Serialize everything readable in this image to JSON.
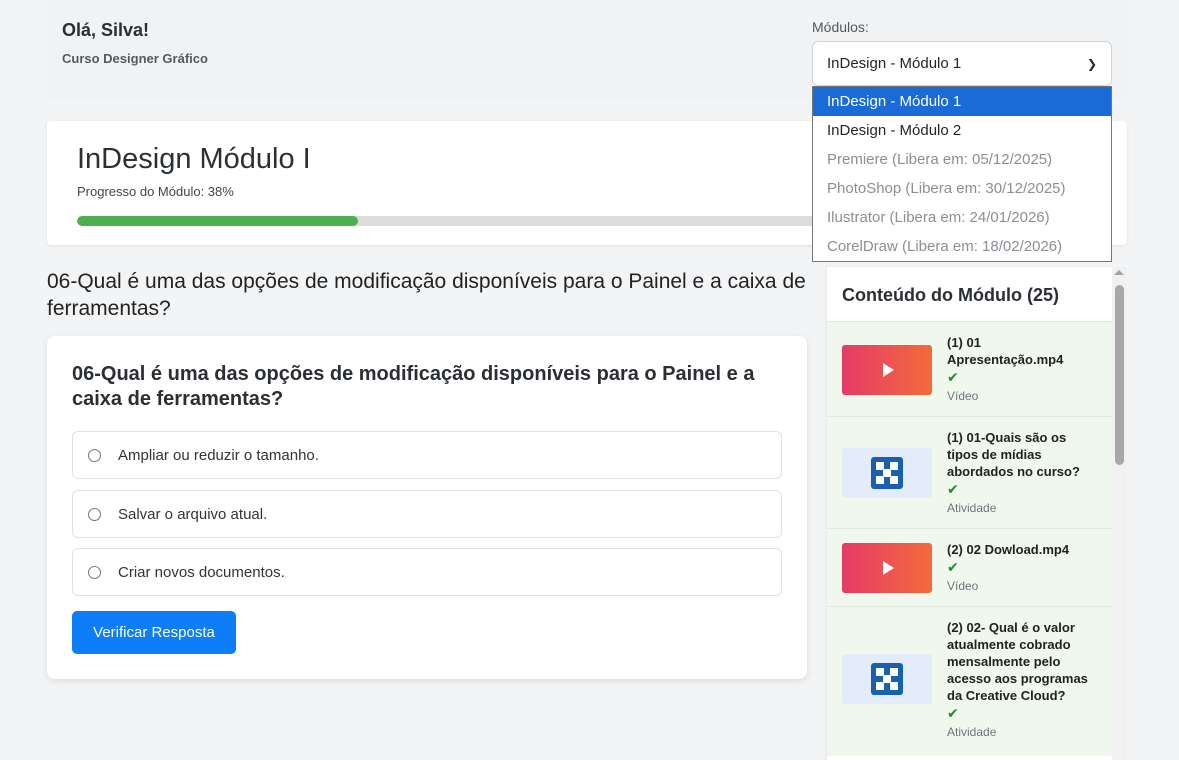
{
  "header": {
    "greeting": "Olá, Silva!",
    "course": "Curso Designer Gráfico",
    "modules_label": "Módulos:",
    "selected_module": "InDesign - Módulo 1"
  },
  "module_options": [
    {
      "label": "InDesign - Módulo 1",
      "state": "selected"
    },
    {
      "label": "InDesign - Módulo 2",
      "state": "enabled"
    },
    {
      "label": "Premiere (Libera em: 05/12/2025)",
      "state": "disabled"
    },
    {
      "label": "PhotoShop (Libera em: 30/12/2025)",
      "state": "disabled"
    },
    {
      "label": "Ilustrator (Libera em: 24/01/2026)",
      "state": "disabled"
    },
    {
      "label": "CorelDraw (Libera em: 18/02/2026)",
      "state": "disabled"
    }
  ],
  "module": {
    "title": "InDesign Módulo I",
    "progress_label": "Progresso do Módulo: 38%",
    "progress_percent": 38
  },
  "question": {
    "heading": "06-Qual é uma das opções de modificação disponíveis para o Painel e a caixa de ferramentas?",
    "card_title": "06-Qual é uma das opções de modificação disponíveis para o Painel e a caixa de ferramentas?",
    "options": [
      "Ampliar ou reduzir o tamanho.",
      "Salvar o arquivo atual.",
      "Criar novos documentos."
    ],
    "verify_label": "Verificar Resposta"
  },
  "sidebar": {
    "title": "Conteúdo do Módulo (25)",
    "items": [
      {
        "title": "(1) 01 Apresentação.mp4",
        "check": "✔",
        "type": "Vídeo",
        "kind": "video"
      },
      {
        "title": "(1) 01-Quais são os tipos de mídias abordados no curso?",
        "check": "✔",
        "type": "Atividade",
        "kind": "activity"
      },
      {
        "title": "(2) 02 Dowload.mp4",
        "check": "✔",
        "type": "Vídeo",
        "kind": "video"
      },
      {
        "title": "(2) 02- Qual é o valor atualmente cobrado mensalmente pelo acesso aos programas da Creative Cloud?",
        "check": "✔",
        "type": "Atividade",
        "kind": "activity"
      }
    ]
  },
  "colors": {
    "accent": "#0d7ef7",
    "progress": "#4caf50",
    "selected_option": "#1a6bd8",
    "completed_bg": "#f0f8ee"
  }
}
